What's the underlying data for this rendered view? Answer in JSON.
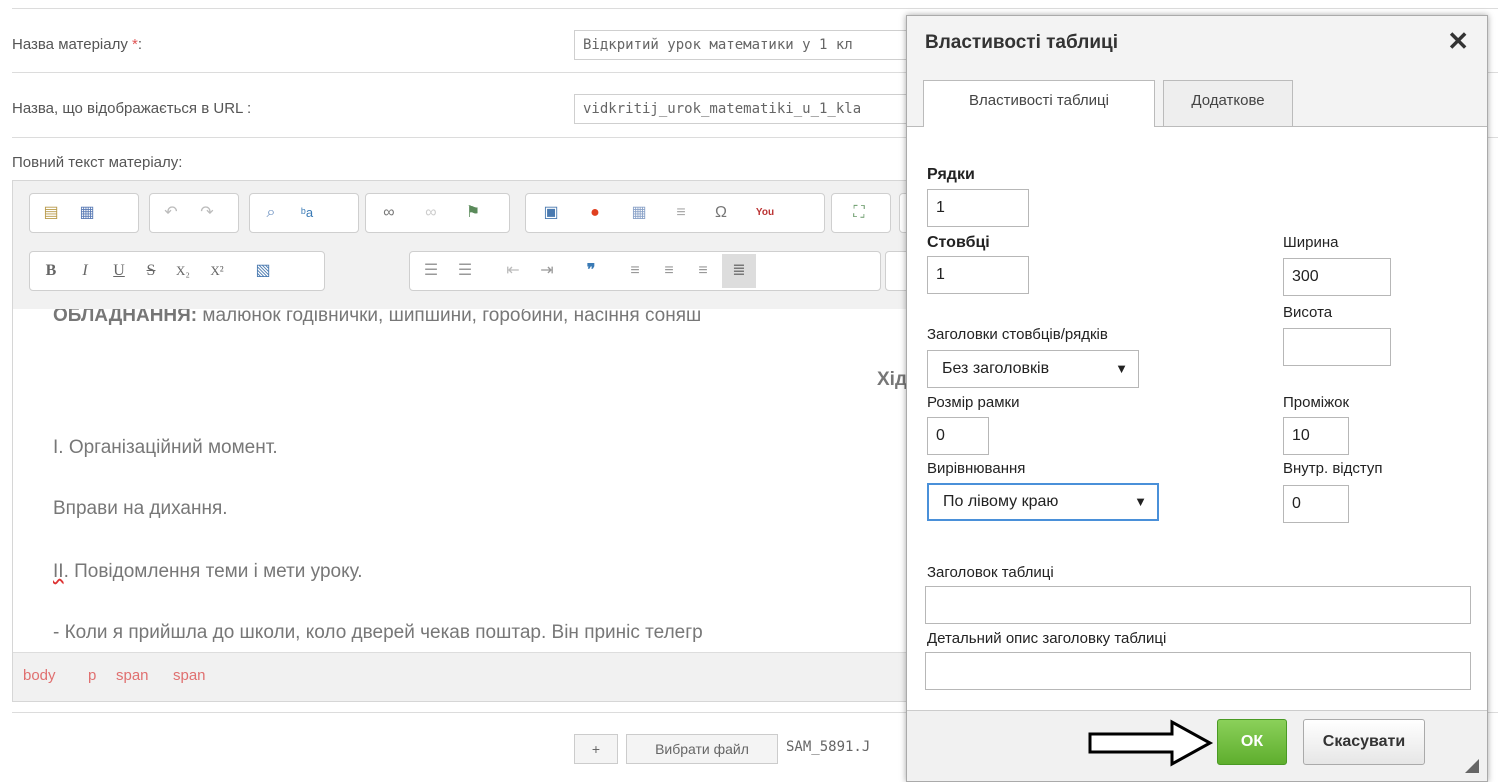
{
  "form": {
    "title_label": "Назва матеріалу",
    "title_required_mark": "*",
    "title_suffix": ":",
    "title_value": "Відкритий урок математики у 1 кл",
    "url_label": "Назва, що відображається в URL :",
    "url_value": "vidkritij_urok_matematiki_u_1_kla",
    "fulltext_label": "Повний текст матеріалу:"
  },
  "toolbar": {
    "rows": [
      [
        "template-icon",
        "source-icon",
        "undo-icon",
        "redo-icon",
        "find-icon",
        "replace-icon",
        "link-icon",
        "unlink-icon",
        "anchor-icon",
        "image-icon",
        "flash-icon",
        "table-icon",
        "hr-icon",
        "special-char-icon",
        "youtube-icon",
        "maximize-icon"
      ],
      [
        "bold-icon",
        "italic-icon",
        "underline-icon",
        "strike-icon",
        "subscript-icon",
        "superscript-icon",
        "remove-format-icon",
        "numbered-list-icon",
        "bulleted-list-icon",
        "outdent-icon",
        "indent-icon",
        "blockquote-icon",
        "align-left-icon",
        "align-center-icon",
        "align-right-icon",
        "justify-icon"
      ]
    ],
    "glyphs": {
      "bold": "B",
      "italic": "I",
      "underline": "U",
      "strike": "S",
      "subscript": "X₂",
      "superscript": "X²",
      "quote": "❞",
      "omega": "Ω",
      "youtube": "You"
    }
  },
  "editor": {
    "paragraphs": [
      {
        "prefix": "ОБЛАДНАННЯ:",
        "text": " малюнок годівнички, шипшини, горобини, насіння соняш"
      },
      {
        "text": "Хід"
      },
      {
        "text": "І. Організаційний момент."
      },
      {
        "text": "Вправи на дихання."
      },
      {
        "prefix": "ІІ",
        "text": ". Повідомлення теми і мети уроку."
      },
      {
        "text": "- Коли я прийшла до школи, коло дверей чекав поштар. Він приніс телегр"
      }
    ],
    "path": [
      "body",
      "p",
      "span",
      "span"
    ]
  },
  "attach": {
    "plus": "+",
    "choose_file": "Вибрати файл",
    "file_name": "SAM_5891.J"
  },
  "dialog": {
    "title": "Властивості таблиці",
    "close_glyph": "✕",
    "tabs": [
      "Властивості таблиці",
      "Додаткове"
    ],
    "rows_label": "Рядки",
    "rows_value": "1",
    "cols_label": "Стовбці",
    "cols_value": "1",
    "width_label": "Ширина",
    "width_value": "300",
    "height_label": "Висота",
    "height_value": "",
    "headers_label": "Заголовки стовбців/рядків",
    "headers_value": "Без заголовків",
    "border_label": "Розмір рамки",
    "border_value": "0",
    "spacing_label": "Проміжок",
    "spacing_value": "10",
    "align_label": "Вирівнювання",
    "align_value": "По лівому краю",
    "padding_label": "Внутр. відступ",
    "padding_value": "0",
    "caption_label": "Заголовок таблиці",
    "caption_value": "",
    "summary_label": "Детальний опис заголовку таблиці",
    "summary_value": "",
    "ok_label": "ОК",
    "cancel_label": "Скасувати",
    "select_arrow": "▼"
  },
  "colors": {
    "ok_green": "#5fae2e",
    "path_link": "#e07070",
    "required": "#e05555"
  }
}
